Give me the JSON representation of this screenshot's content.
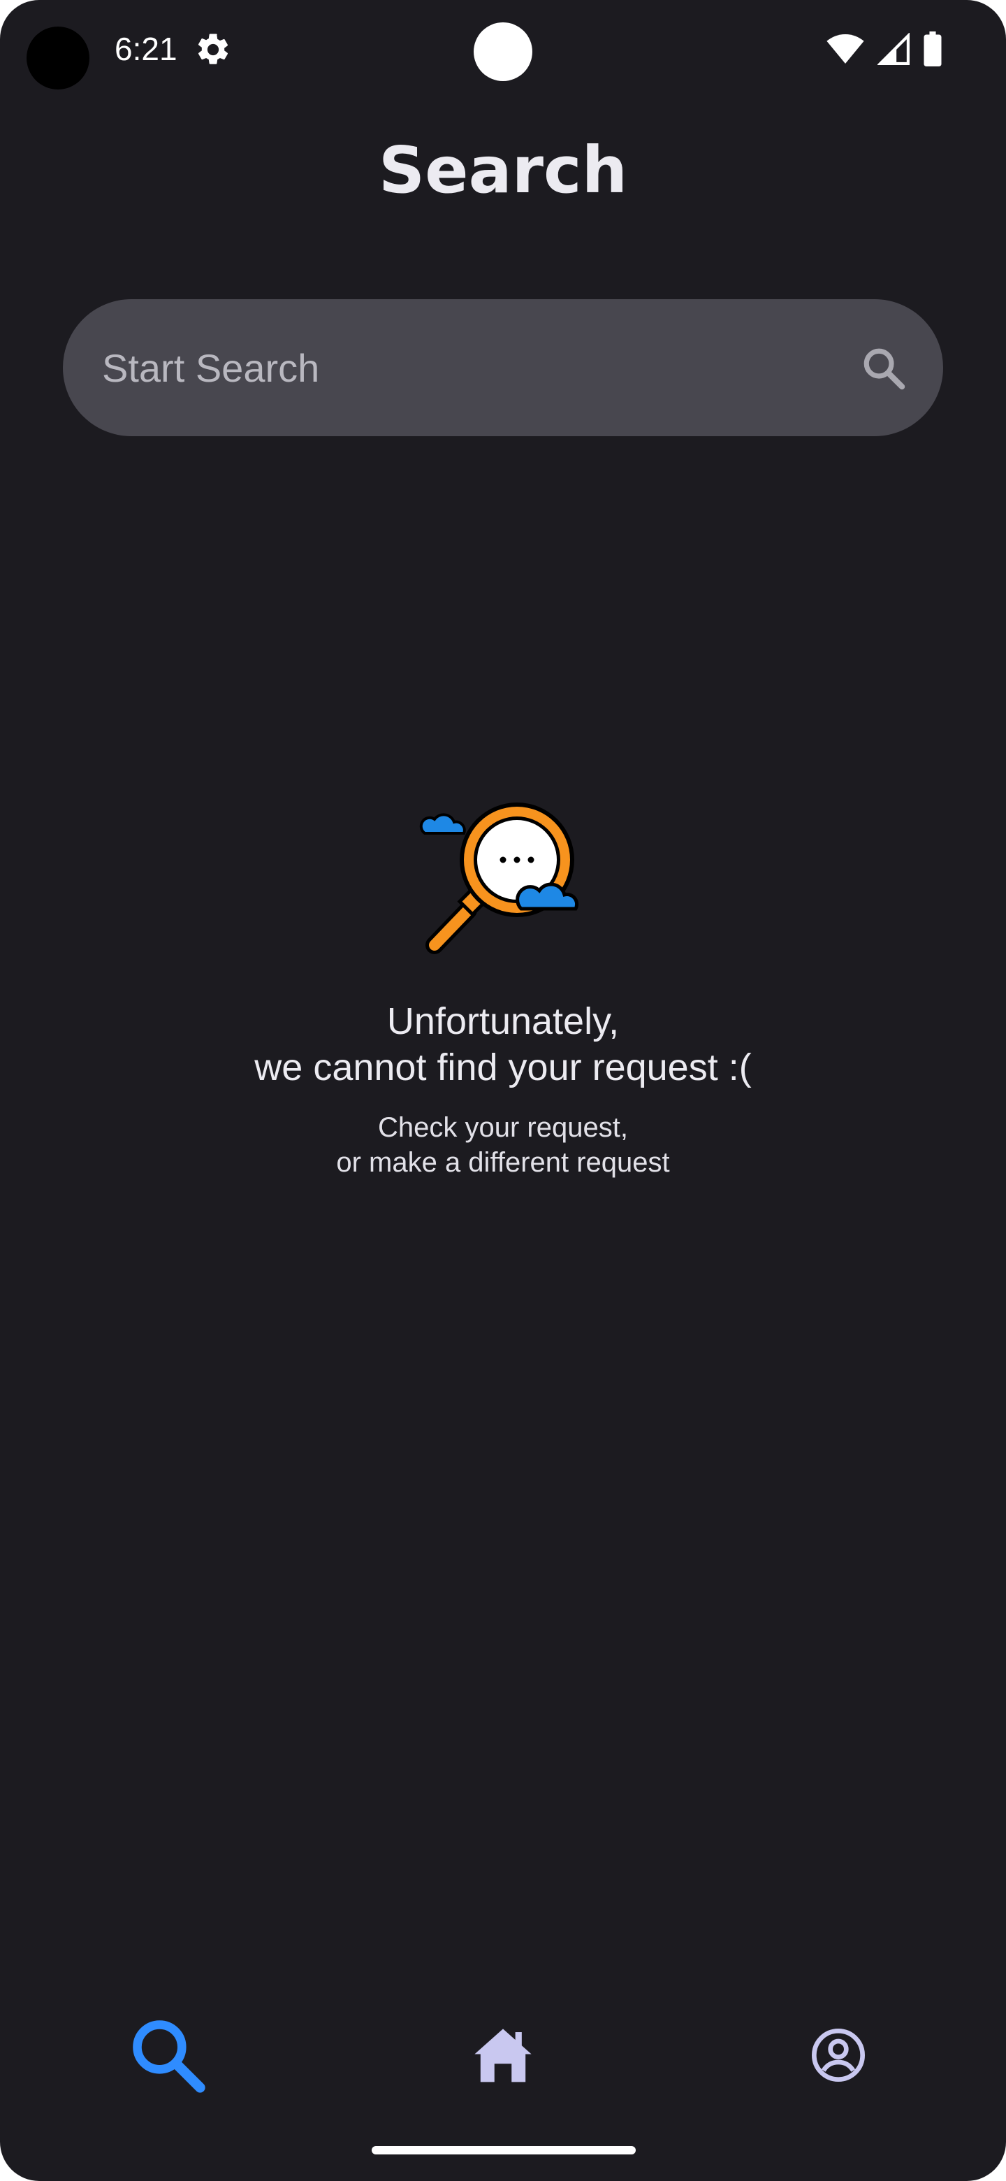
{
  "status_bar": {
    "time": "6:21"
  },
  "header": {
    "title": "Search"
  },
  "search": {
    "placeholder": "Start Search",
    "value": ""
  },
  "empty_state": {
    "title_line1": "Unfortunately,",
    "title_line2": "we cannot find your request :(",
    "subtitle_line1": "Check your request,",
    "subtitle_line2": "or make a different request"
  },
  "bottom_nav": {
    "active": "search",
    "items": [
      {
        "id": "search",
        "icon": "search-icon"
      },
      {
        "id": "home",
        "icon": "home-icon"
      },
      {
        "id": "profile",
        "icon": "account-circle-icon"
      }
    ]
  },
  "colors": {
    "background": "#1c1b20",
    "search_bar": "#48474f",
    "active_nav": "#2f8cff",
    "inactive_nav": "#c9c8f0",
    "magnifier_orange": "#f7931e",
    "cloud_blue": "#1e88e5"
  }
}
